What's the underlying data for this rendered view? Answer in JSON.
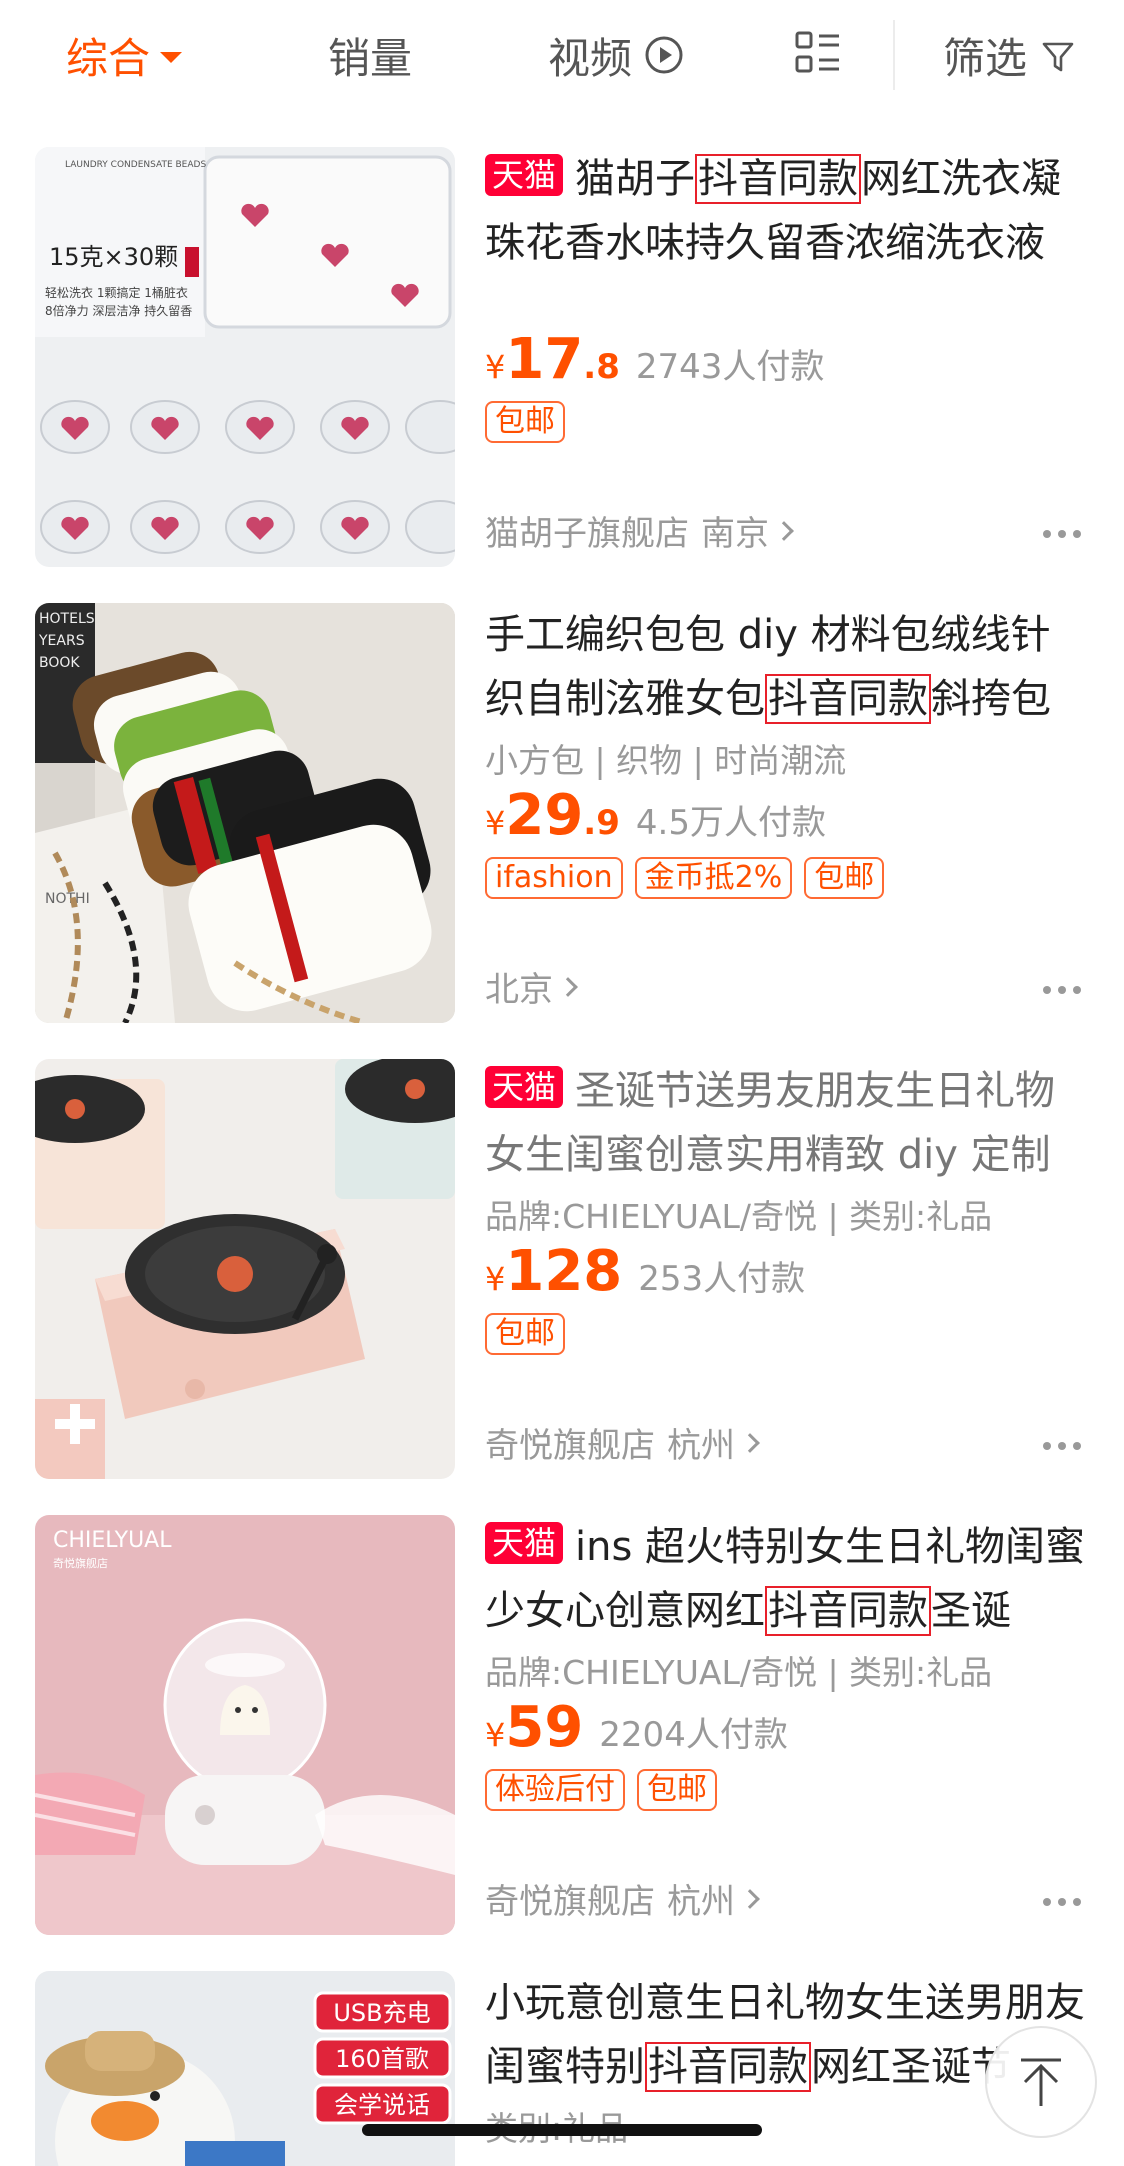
{
  "filter_bar": {
    "tabs": [
      {
        "label": "综合",
        "active": true
      },
      {
        "label": "销量",
        "active": false
      },
      {
        "label": "视频",
        "active": false
      }
    ],
    "filter_label": "筛选",
    "icons": [
      "chevron-down-icon",
      "play-circle-icon",
      "list-layout-icon",
      "funnel-icon"
    ],
    "accent_color": "#ff5000"
  },
  "products": [
    {
      "tmall_badge": "天猫",
      "title_pre": "猫胡子",
      "title_hl": "抖音同款",
      "title_post": "网红洗衣凝珠花香水味持久留香浓缩洗衣液",
      "currency": "¥",
      "price_int": "17",
      "price_dec": ".8",
      "sales": "2743人付款",
      "tags": [
        "包邮"
      ],
      "shop": "猫胡子旗舰店",
      "location": "南京",
      "image_text": [
        "15克×30颗",
        "轻松洗衣 1颗搞定 1桶脏衣",
        "8倍净力 深层洁净 持久留香",
        "LAUNDRY CONDENSATE BEADS"
      ]
    },
    {
      "title_pre": "手工编织包包 diy 材料包绒线针织自制泫雅女包",
      "title_hl": "抖音同款",
      "title_post": "斜挎包",
      "attrs": "小方包 | 织物 | 时尚潮流",
      "currency": "¥",
      "price_int": "29",
      "price_dec": ".9",
      "sales": "4.5万人付款",
      "tags": [
        "ifashion",
        "金币抵2%",
        "包邮"
      ],
      "location": "北京",
      "image_text": [
        "HOTELS",
        "YEARS",
        "BOOK",
        "NOTHI"
      ]
    },
    {
      "tmall_badge": "天猫",
      "title_pre": "圣诞节送男友朋友生日礼物女生闺蜜创意实用精致 diy 定制",
      "attrs": "品牌:CHIELYUAL/奇悦 | 类别:礼品",
      "currency": "¥",
      "price_int": "128",
      "price_dec": "",
      "sales": "253人付款",
      "tags": [
        "包邮"
      ],
      "shop": "奇悦旗舰店",
      "location": "杭州"
    },
    {
      "tmall_badge": "天猫",
      "title_pre": "ins 超火特别女生日礼物闺蜜少女心创意网红",
      "title_hl": "抖音同款",
      "title_post": "圣诞",
      "attrs": "品牌:CHIELYUAL/奇悦 | 类别:礼品",
      "currency": "¥",
      "price_int": "59",
      "price_dec": "",
      "sales": "2204人付款",
      "tags": [
        "体验后付",
        "包邮"
      ],
      "shop": "奇悦旗舰店",
      "location": "杭州",
      "image_text": [
        "CHIELYUAL",
        "奇悦旗舰店"
      ]
    },
    {
      "title_pre": "小玩意创意生日礼物女生送男朋友闺蜜特别",
      "title_hl": "抖音同款",
      "title_post": "网红圣诞节",
      "attrs": "类别:礼品",
      "image_labels": [
        "USB充电",
        "160首歌",
        "会学说话"
      ]
    }
  ]
}
